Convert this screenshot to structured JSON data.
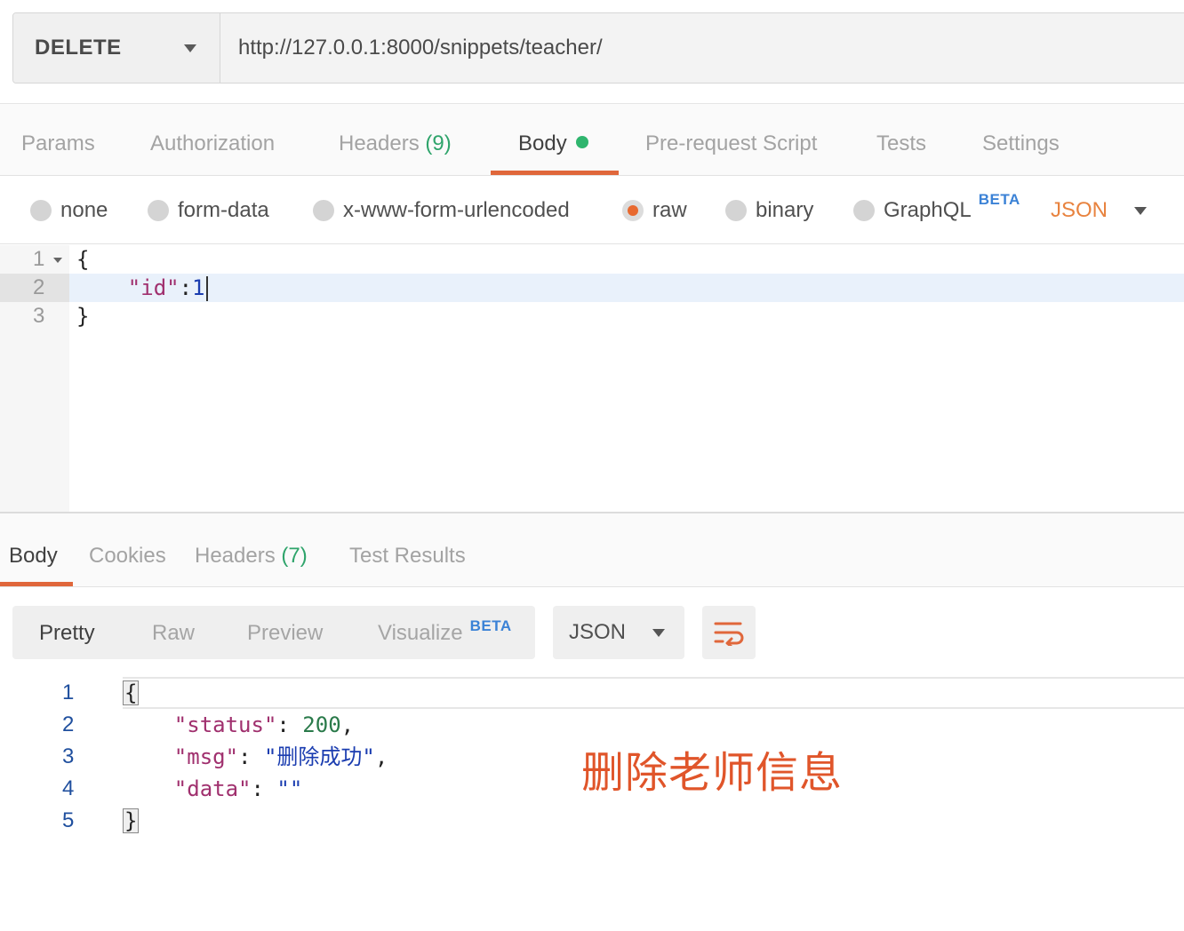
{
  "request": {
    "method": "DELETE",
    "url": "http://127.0.0.1:8000/snippets/teacher/"
  },
  "request_tabs": [
    {
      "label": "Params"
    },
    {
      "label": "Authorization"
    },
    {
      "label": "Headers",
      "count": "(9)"
    },
    {
      "label": "Body"
    },
    {
      "label": "Pre-request Script"
    },
    {
      "label": "Tests"
    },
    {
      "label": "Settings"
    }
  ],
  "body_types": {
    "options": [
      "none",
      "form-data",
      "x-www-form-urlencoded",
      "raw",
      "binary",
      "GraphQL"
    ],
    "selected": "raw",
    "graphql_badge": "BETA",
    "language": "JSON"
  },
  "request_body": {
    "line_numbers": [
      "1",
      "2",
      "3"
    ],
    "lines": [
      "{",
      "    \"id\":1",
      "}"
    ]
  },
  "response_tabs": [
    {
      "label": "Body"
    },
    {
      "label": "Cookies"
    },
    {
      "label": "Headers",
      "count": "(7)"
    },
    {
      "label": "Test Results"
    }
  ],
  "response_toolbar": {
    "views": [
      "Pretty",
      "Raw",
      "Preview",
      "Visualize"
    ],
    "visualize_badge": "BETA",
    "format": "JSON"
  },
  "response_body": {
    "line_numbers": [
      "1",
      "2",
      "3",
      "4",
      "5"
    ],
    "open_brace": "{",
    "close_brace": "}",
    "status_key": "\"status\"",
    "status_value": "200",
    "msg_key": "\"msg\"",
    "msg_value": "\"删除成功\"",
    "data_key": "\"data\"",
    "data_value": "\"\""
  },
  "annotation": "删除老师信息",
  "colors": {
    "accent": "#e0673b",
    "count_green": "#2fa46b",
    "beta_blue": "#3b82d6",
    "annotation_red": "#e0552a"
  }
}
